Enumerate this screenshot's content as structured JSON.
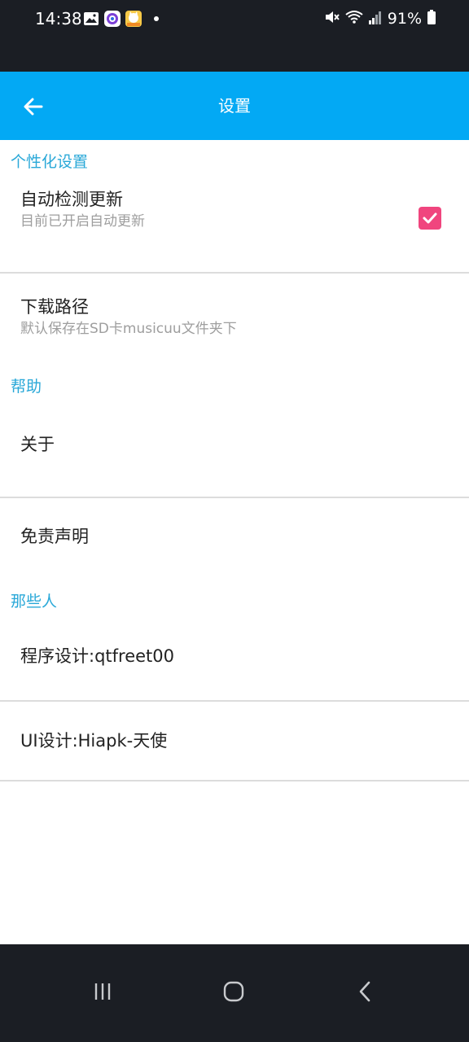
{
  "status_bar": {
    "time": "14:38",
    "battery": "91%",
    "icons": [
      "gallery-icon",
      "camera-app-icon",
      "cat-app-icon",
      "notification-dot",
      "mute-icon",
      "wifi-icon",
      "signal-icon",
      "battery-icon"
    ]
  },
  "app_bar": {
    "title": "设置",
    "back_icon": "arrow-left-icon",
    "color": "#03a9f4"
  },
  "sections": {
    "personal": {
      "header": "个性化设置",
      "auto_update": {
        "title": "自动检测更新",
        "summary": "目前已开启自动更新",
        "checked": true
      },
      "download_path": {
        "title": "下载路径",
        "summary": "默认保存在SD卡musicuu文件夹下"
      }
    },
    "help": {
      "header": "帮助",
      "about": {
        "title": "关于"
      },
      "disclaimer": {
        "title": "免责声明"
      }
    },
    "people": {
      "header": "那些人",
      "programmer": {
        "title": "程序设计:qtfreet00"
      },
      "designer": {
        "title": "UI设计:Hiapk-天使"
      }
    }
  },
  "colors": {
    "accent_header": "#29a8d8",
    "checkbox": "#f0457e",
    "system_bars": "#1b1e24"
  },
  "nav_bar": {
    "icons": [
      "recent-apps-icon",
      "home-icon",
      "back-icon"
    ]
  }
}
